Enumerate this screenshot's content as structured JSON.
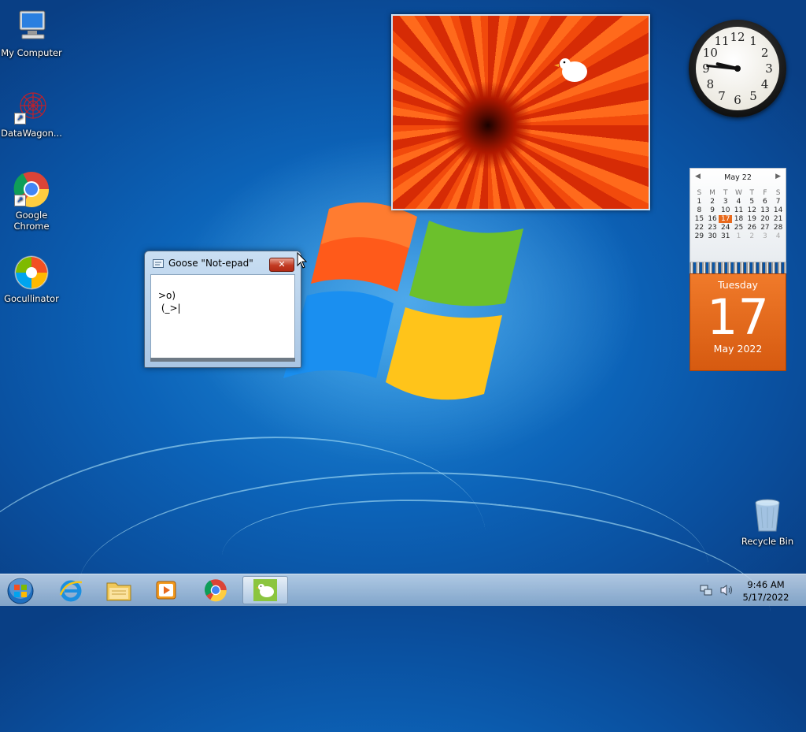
{
  "desktop": {
    "icons": [
      {
        "label": "My Computer",
        "icon": "computer-icon"
      },
      {
        "label": "DataWagon...",
        "icon": "datawagon-icon"
      },
      {
        "label": "Google Chrome",
        "icon": "chrome-icon"
      },
      {
        "label": "Gocullinator",
        "icon": "shield-icon"
      },
      {
        "label": "Recycle Bin",
        "icon": "recycle-bin-icon"
      }
    ]
  },
  "notepad": {
    "title": "Goose \"Not-epad\"",
    "close_label": "✕",
    "content": ">o)\n (_>|"
  },
  "calendar": {
    "month_label": "May 22",
    "weekdays": [
      "S",
      "M",
      "T",
      "W",
      "T",
      "F",
      "S"
    ],
    "days": [
      [
        "1",
        "2",
        "3",
        "4",
        "5",
        "6",
        "7"
      ],
      [
        "8",
        "9",
        "10",
        "11",
        "12",
        "13",
        "14"
      ],
      [
        "15",
        "16",
        "17",
        "18",
        "19",
        "20",
        "21"
      ],
      [
        "22",
        "23",
        "24",
        "25",
        "26",
        "27",
        "28"
      ],
      [
        "29",
        "30",
        "31",
        "1",
        "2",
        "3",
        "4"
      ]
    ],
    "weekday_name": "Tuesday",
    "day_number": "17",
    "month_year": "May 2022"
  },
  "clock": {
    "numbers": [
      "12",
      "1",
      "2",
      "3",
      "4",
      "5",
      "6",
      "7",
      "8",
      "9",
      "10",
      "11"
    ]
  },
  "tray": {
    "time": "9:46 AM",
    "date": "5/17/2022"
  },
  "taskbar": {
    "items": [
      "start-orb-icon",
      "internet-explorer-icon",
      "file-explorer-icon",
      "media-player-icon",
      "chrome-icon",
      "goose-icon"
    ]
  },
  "colors": {
    "accent": "#1a6fc9",
    "calendar_orange": "#e8691c"
  }
}
